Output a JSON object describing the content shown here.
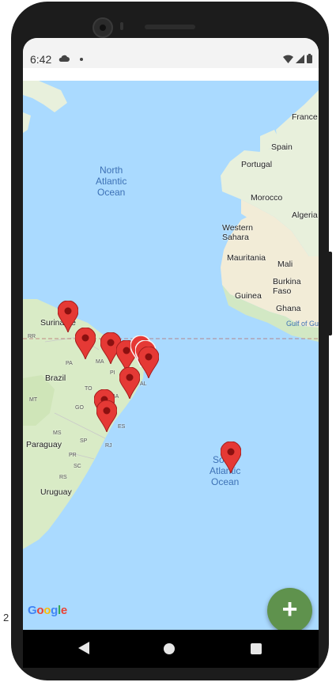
{
  "status_bar": {
    "time": "6:42"
  },
  "map": {
    "ocean_labels": {
      "north_atlantic": "North\nAtlantic\nOcean",
      "south_atlantic": "South\nAtlantic\nOcean",
      "gulf": "Gulf of Gu"
    },
    "country_labels": {
      "france": "France",
      "spain": "Spain",
      "portugal": "Portugal",
      "morocco": "Morocco",
      "algeria": "Algeria",
      "western_sahara": "Western\nSahara",
      "mauritania": "Mauritania",
      "mali": "Mali",
      "burkina_faso": "Burkina\nFaso",
      "guinea": "Guinea",
      "ghana": "Ghana",
      "suriname": "Suriname",
      "brazil": "Brazil",
      "paraguay": "Paraguay",
      "uruguay": "Uruguay",
      "rr": "RR"
    },
    "state_labels": [
      "MA",
      "PA",
      "PI",
      "AL",
      "TO",
      "BA",
      "MT",
      "GO",
      "MG",
      "ES",
      "MS",
      "SP",
      "RJ",
      "PR",
      "SC",
      "RS"
    ],
    "attribution": "Google",
    "marker_count": 12
  },
  "fab": {
    "label": "+"
  },
  "edge_text": "2",
  "colors": {
    "ocean": "#aadaff",
    "land": "#e8f0dc",
    "marker": "#e53935",
    "fab": "#5f924d"
  }
}
